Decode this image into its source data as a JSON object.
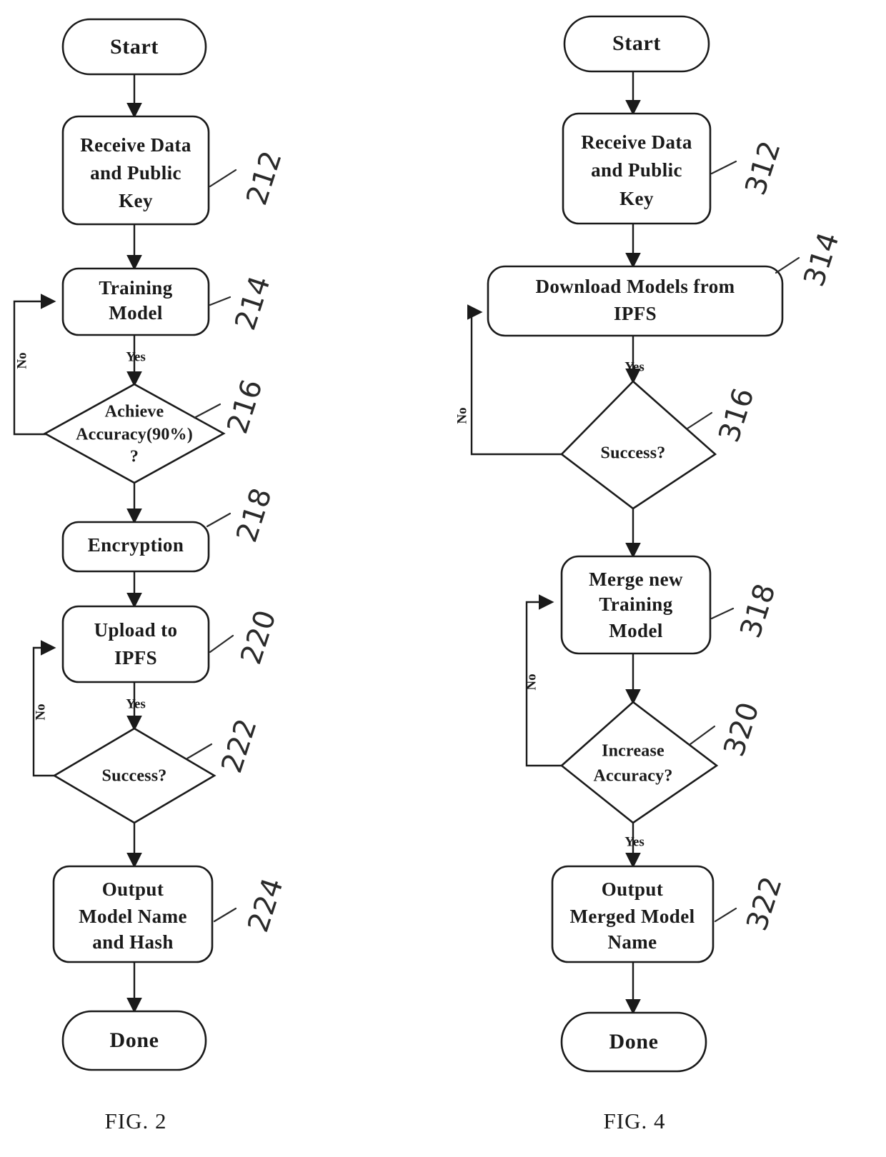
{
  "figures": [
    {
      "id": "fig-2",
      "caption": "FIG. 2",
      "nodes": [
        {
          "id": "start",
          "kind": "terminal",
          "lines": [
            "Start"
          ]
        },
        {
          "id": "receive",
          "kind": "process",
          "lines": [
            "Receive Data",
            "and Public",
            "Key"
          ],
          "ref": "212"
        },
        {
          "id": "training",
          "kind": "process",
          "lines": [
            "Training",
            "Model"
          ],
          "ref": "214"
        },
        {
          "id": "achieve",
          "kind": "decision",
          "lines": [
            "Achieve",
            "Accuracy(90%)",
            "?"
          ],
          "ref": "216"
        },
        {
          "id": "encryption",
          "kind": "process",
          "lines": [
            "Encryption"
          ],
          "ref": "218"
        },
        {
          "id": "upload",
          "kind": "process",
          "lines": [
            "Upload to",
            "IPFS"
          ],
          "ref": "220"
        },
        {
          "id": "success",
          "kind": "decision",
          "lines": [
            "Success?"
          ],
          "ref": "222"
        },
        {
          "id": "output",
          "kind": "process",
          "lines": [
            "Output",
            "Model Name",
            "and Hash"
          ],
          "ref": "224"
        },
        {
          "id": "done",
          "kind": "terminal",
          "lines": [
            "Done"
          ]
        }
      ],
      "edge_labels": [
        {
          "id": "training-yes",
          "text": "Yes"
        },
        {
          "id": "achieve-no",
          "text": "No"
        },
        {
          "id": "upload-yes",
          "text": "Yes"
        },
        {
          "id": "success-no",
          "text": "No"
        }
      ]
    },
    {
      "id": "fig-4",
      "caption": "FIG. 4",
      "nodes": [
        {
          "id": "start",
          "kind": "terminal",
          "lines": [
            "Start"
          ]
        },
        {
          "id": "receive",
          "kind": "process",
          "lines": [
            "Receive Data",
            "and Public",
            "Key"
          ],
          "ref": "312"
        },
        {
          "id": "download",
          "kind": "process",
          "lines": [
            "Download Models from",
            "IPFS"
          ],
          "ref": "314"
        },
        {
          "id": "success",
          "kind": "decision",
          "lines": [
            "Success?"
          ],
          "ref": "316"
        },
        {
          "id": "merge",
          "kind": "process",
          "lines": [
            "Merge new",
            "Training",
            "Model"
          ],
          "ref": "318"
        },
        {
          "id": "increase",
          "kind": "decision",
          "lines": [
            "Increase",
            "Accuracy?"
          ],
          "ref": "320"
        },
        {
          "id": "output",
          "kind": "process",
          "lines": [
            "Output",
            "Merged Model",
            "Name"
          ],
          "ref": "322"
        },
        {
          "id": "done",
          "kind": "terminal",
          "lines": [
            "Done"
          ]
        }
      ],
      "edge_labels": [
        {
          "id": "download-yes",
          "text": "Yes"
        },
        {
          "id": "success-no",
          "text": "No"
        },
        {
          "id": "merge-no",
          "text": "No"
        },
        {
          "id": "increase-yes",
          "text": "Yes"
        }
      ]
    }
  ],
  "colors": {
    "ink": "#1a1a1a",
    "paper": "#ffffff",
    "ref_ink": "#2a2a2a"
  }
}
